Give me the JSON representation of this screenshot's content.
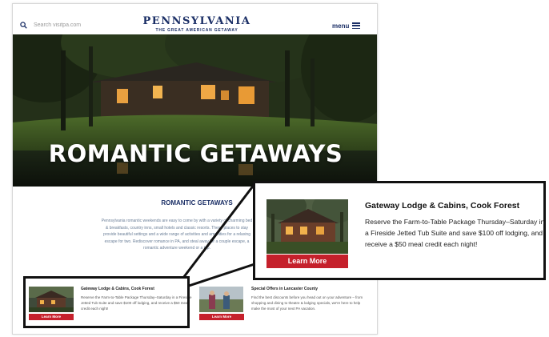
{
  "header": {
    "search_placeholder": "Search visitpa.com",
    "logo_main": "PENNSYLVANIA",
    "logo_sub": "THE GREAT AMERICAN GETAWAY",
    "menu_label": "menu"
  },
  "hero": {
    "title": "ROMANTIC GETAWAYS"
  },
  "section": {
    "title": "ROMANTIC GETAWAYS",
    "intro": "Pennsylvania romantic weekends are easy to come by with a variety of charming bed & breakfasts, country inns, small hotels and classic resorts. These places to stay provide beautiful settings and a wide range of activities and amenities for a relaxing escape for two. Rediscover romance in PA, and steal away for a couple escape, a romantic adventure weekend or a trip."
  },
  "cards": [
    {
      "title": "Gateway Lodge & Cabins, Cook Forest",
      "body": "Reserve the Farm-to-Table Package Thursday–Saturday in a Fireside Jetted Tub Suite and save $100 off lodging, and receive a $50 meal credit each night!",
      "button": "Learn More"
    },
    {
      "title": "Special Offers in Lancaster County",
      "body": "Find the best discounts before you head out on your adventure – from shopping and dining to theatre & lodging specials, we're here to help make the most of your next PA vacation.",
      "button": "Learn More"
    }
  ],
  "callout": {
    "title": "Gateway Lodge & Cabins, Cook Forest",
    "body": "Reserve the Farm-to-Table Package Thursday–Saturday in a Fireside Jetted Tub Suite and save $100 off lodging, and receive a $50 meal credit each night!",
    "button": "Learn More"
  },
  "colors": {
    "brand_navy": "#1b2f66",
    "button_red": "#c5202b",
    "frame_black": "#111111"
  }
}
